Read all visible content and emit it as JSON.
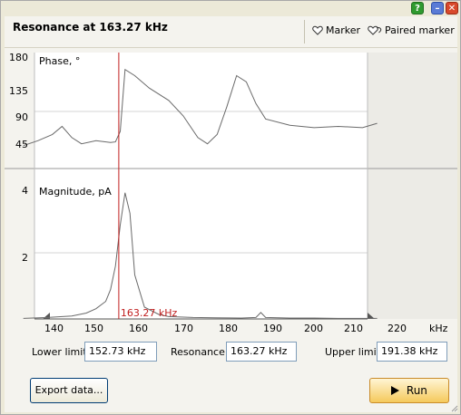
{
  "window": {
    "help_glyph": "?",
    "min_glyph": "–",
    "close_glyph": "✕"
  },
  "header": {
    "title": "Resonance at 163.27 kHz",
    "marker_label": "Marker",
    "paired_marker_label": "Paired marker",
    "marker_icon": "heart-outline-icon",
    "paired_marker_icon": "paired-heart-icon"
  },
  "chart_data": [
    {
      "type": "line",
      "title": "Phase, °",
      "y_ticks": [
        "180",
        "135",
        "90",
        "45"
      ],
      "ylim": [
        0,
        180
      ],
      "x": [
        140,
        143,
        146,
        148,
        150,
        152,
        155,
        158,
        159,
        160,
        161,
        163,
        166,
        170,
        173,
        176,
        178,
        180,
        182,
        184,
        186,
        188,
        190,
        195,
        200,
        205,
        210,
        213
      ],
      "values": [
        37,
        45,
        55,
        68,
        50,
        40,
        45,
        42,
        43,
        60,
        160,
        150,
        130,
        110,
        85,
        50,
        40,
        55,
        100,
        150,
        140,
        105,
        80,
        70,
        66,
        68,
        66,
        73
      ],
      "color": "#6a6a6a"
    },
    {
      "type": "line",
      "title": "Magnitude, pA",
      "y_ticks": [
        "4",
        "2"
      ],
      "ylim": [
        0,
        4.6
      ],
      "x": [
        140,
        145,
        150,
        153,
        155,
        157,
        158,
        159,
        160,
        161,
        162,
        163,
        165,
        168,
        170,
        175,
        180,
        185,
        188,
        189,
        190,
        195,
        200,
        205,
        210,
        213
      ],
      "values": [
        0.02,
        0.05,
        0.1,
        0.2,
        0.35,
        0.6,
        1.0,
        1.8,
        3.2,
        4.3,
        3.6,
        1.5,
        0.4,
        0.15,
        0.08,
        0.05,
        0.04,
        0.03,
        0.05,
        0.22,
        0.05,
        0.03,
        0.03,
        0.02,
        0.02,
        0.02
      ],
      "color": "#6a6a6a"
    }
  ],
  "x_axis": {
    "ticks": [
      140,
      150,
      160,
      170,
      180,
      190,
      200,
      210,
      220
    ],
    "unit": "kHz",
    "xlim": [
      138,
      226
    ],
    "data_xlim": [
      140,
      213
    ]
  },
  "marker_readout": "163.27 kHz",
  "marker_freq": 159.7,
  "marker_color": "#c02020",
  "fields": {
    "lower_label": "Lower limit:",
    "lower_value": "152.73 kHz",
    "resonance_label": "Resonance:",
    "resonance_value": "163.27 kHz",
    "upper_label": "Upper limit:",
    "upper_value": "191.38 kHz"
  },
  "buttons": {
    "export_label": "Export data...",
    "run_label": "Run",
    "run_icon": "play-icon"
  }
}
